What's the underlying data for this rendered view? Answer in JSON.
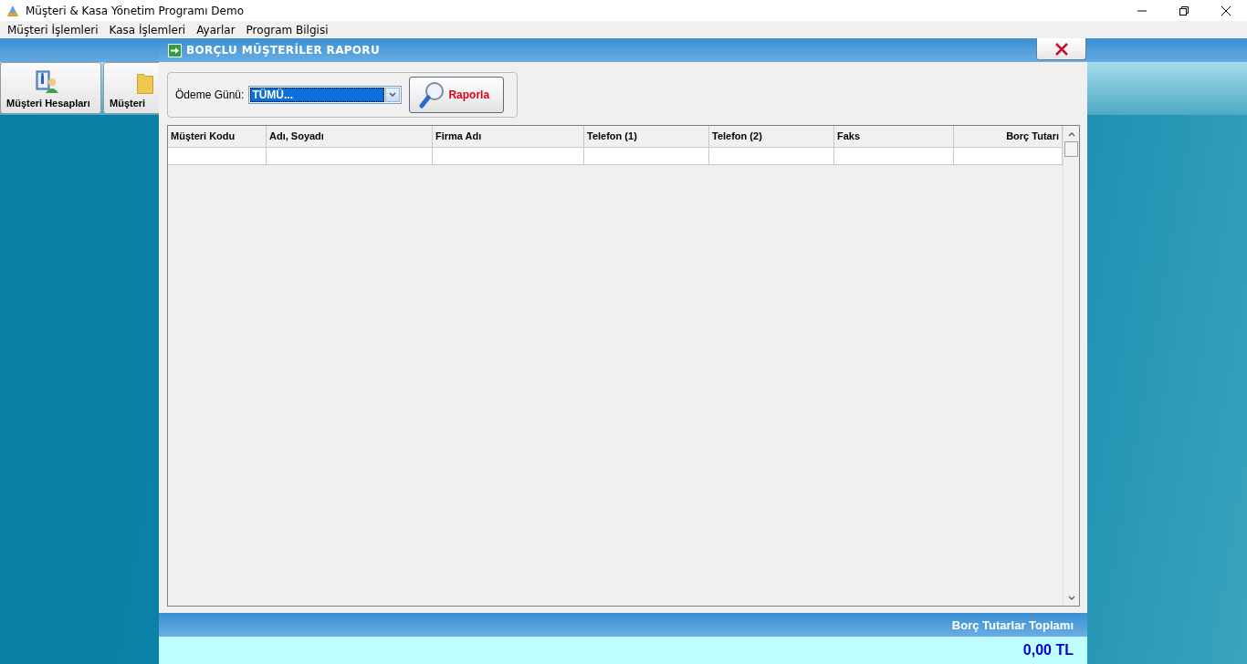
{
  "window": {
    "title": "Müşteri & Kasa Yönetim Programı Demo"
  },
  "menu": [
    {
      "label": "Müşteri İşlemleri"
    },
    {
      "label": "Kasa İşlemleri"
    },
    {
      "label": "Ayarlar"
    },
    {
      "label": "Program Bilgisi"
    }
  ],
  "toolbar": [
    {
      "label": "Müşteri Hesapları",
      "kind": "accounts"
    },
    {
      "label": "Müşteri",
      "kind": "folder"
    }
  ],
  "dialog": {
    "title": "BORÇLU MÜŞTERİLER RAPORU",
    "filter": {
      "label": "Ödeme Günü:",
      "value": "TÜMÜ..."
    },
    "report_button": "Raporla",
    "table": {
      "columns": [
        {
          "label": "Müşteri Kodu"
        },
        {
          "label": "Adı, Soyadı"
        },
        {
          "label": "Firma Adı"
        },
        {
          "label": "Telefon (1)"
        },
        {
          "label": "Telefon (2)"
        },
        {
          "label": "Faks"
        },
        {
          "label": "Borç Tutarı"
        }
      ]
    },
    "footer": {
      "label": "Borç Tutarlar Toplamı",
      "value": "0,00 TL"
    }
  }
}
